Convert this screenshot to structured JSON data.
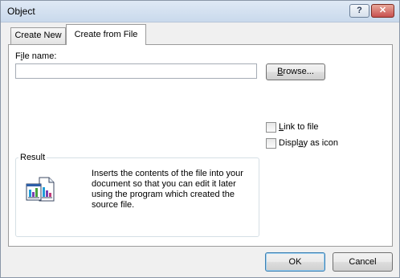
{
  "window": {
    "title": "Object"
  },
  "titlebar": {
    "help_label": "?",
    "close_label": "✕"
  },
  "tabs": [
    {
      "label": "Create New",
      "selected": false
    },
    {
      "label": "Create from File",
      "selected": true
    }
  ],
  "file": {
    "label_prefix": "F",
    "label_underline": "i",
    "label_suffix": "le name:",
    "value": "",
    "browse_underline": "B",
    "browse_suffix": "rowse..."
  },
  "options": {
    "link_underline": "L",
    "link_suffix": "ink to file",
    "link_checked": false,
    "display_prefix": "Displ",
    "display_underline": "a",
    "display_suffix": "y as icon",
    "display_checked": false
  },
  "result": {
    "legend": "Result",
    "description": "Inserts the contents of the file into your document so that you can edit it later using the program which created the source file."
  },
  "footer": {
    "ok_label": "OK",
    "cancel_label": "Cancel"
  }
}
